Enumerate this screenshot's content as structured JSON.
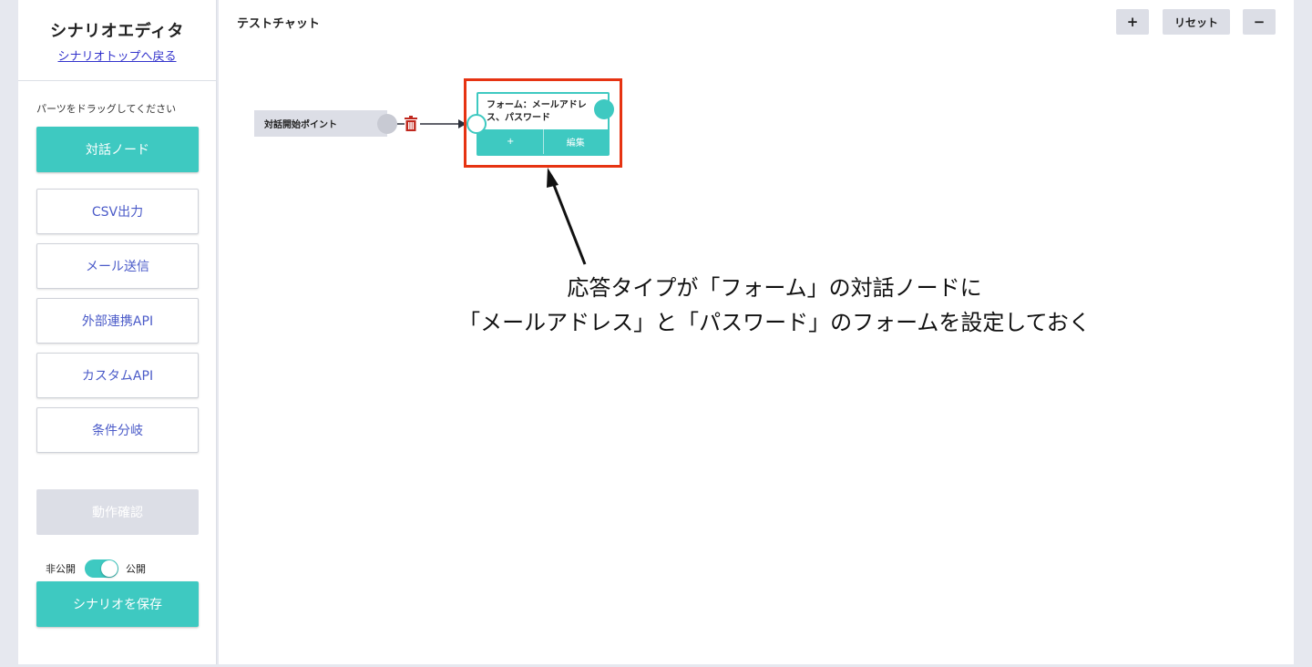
{
  "sidebar": {
    "title": "シナリオエディタ",
    "back_link": "シナリオトップへ戻る",
    "hint": "パーツをドラッグしてください",
    "parts": [
      {
        "label": "対話ノード"
      },
      {
        "label": "CSV出力"
      },
      {
        "label": "メール送信"
      },
      {
        "label": "外部連携API"
      },
      {
        "label": "カスタムAPI"
      },
      {
        "label": "条件分岐"
      }
    ],
    "test_button": "動作確認",
    "toggle": {
      "off_label": "非公開",
      "on_label": "公開",
      "state": "on"
    },
    "save_button": "シナリオを保存"
  },
  "canvas": {
    "title": "テストチャット",
    "toolbar": {
      "zoom_in": "+",
      "reset": "リセット",
      "zoom_out": "−"
    },
    "start_node": {
      "label": "対話開始ポイント"
    },
    "dialog_node": {
      "text": "フォーム：メールアドレス、パスワード",
      "add_label": "+",
      "edit_label": "編集"
    }
  },
  "annotation": {
    "line1": "応答タイプが「フォーム」の対話ノードに",
    "line2": "「メールアドレス」と「パスワード」のフォームを設定しておく"
  },
  "colors": {
    "accent": "#3ec9c1",
    "highlight": "#e63312",
    "link": "#3333cc",
    "trash": "#c0281e"
  },
  "icons": {
    "delete": "trash-icon",
    "arrow": "arrow-icon"
  }
}
